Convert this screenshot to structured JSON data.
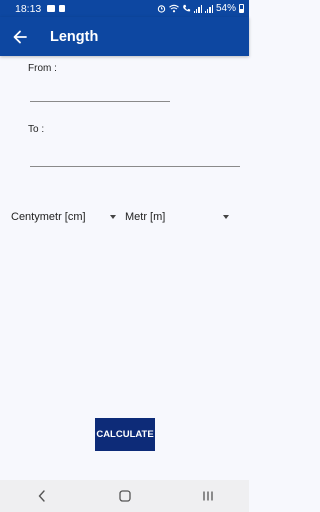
{
  "status_bar": {
    "time": "18:13",
    "battery": "54%"
  },
  "app_bar": {
    "title": "Length"
  },
  "form": {
    "from_label": "From :",
    "from_value": "",
    "to_label": "To :",
    "to_value": ""
  },
  "units": {
    "from_unit": "Centymetr [cm]",
    "to_unit": "Metr [m]"
  },
  "actions": {
    "calculate_label": "CALCULATE"
  },
  "colors": {
    "primary": "#0d47a1",
    "button": "#0d2b78",
    "background": "#f7f8fd"
  }
}
